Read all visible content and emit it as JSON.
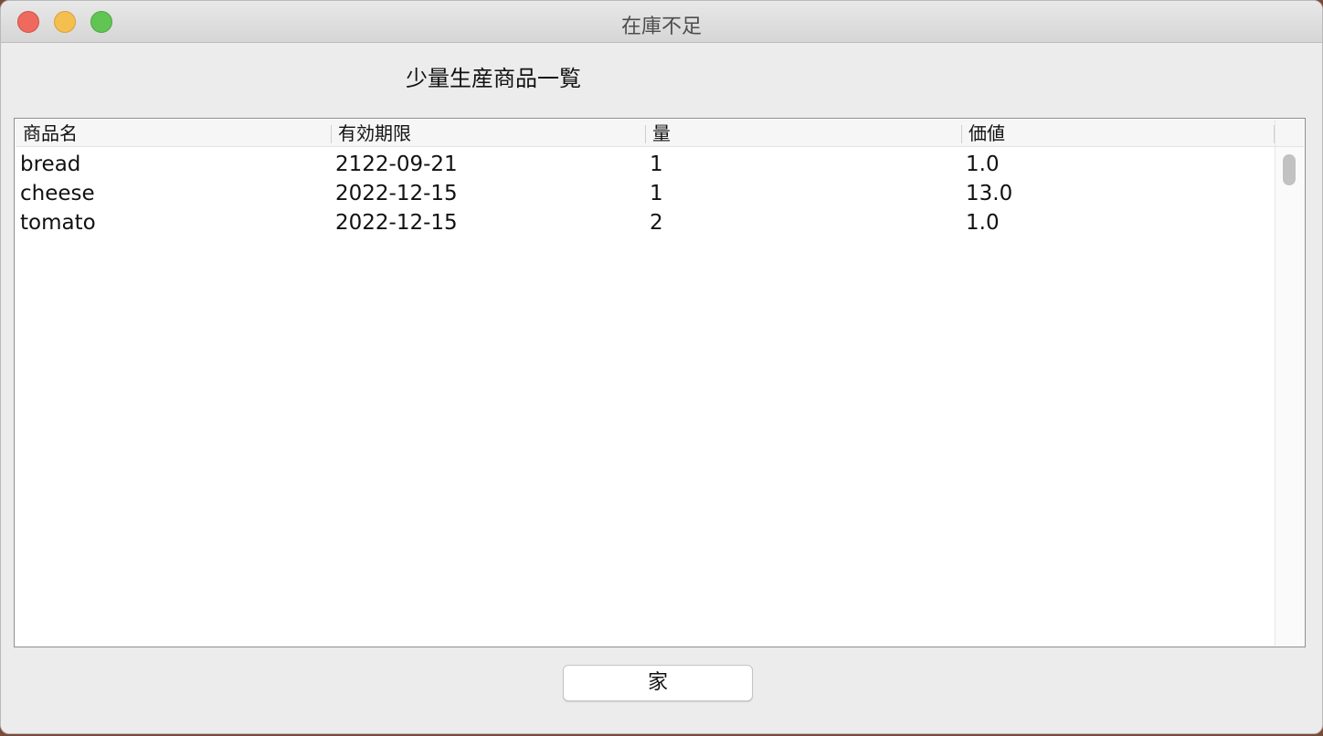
{
  "window": {
    "title": "在庫不足"
  },
  "main": {
    "heading": "少量生産商品一覧",
    "home_button_label": "家"
  },
  "table": {
    "columns": [
      "商品名",
      "有効期限",
      "量",
      "価値"
    ],
    "rows": [
      [
        "bread",
        "2122-09-21",
        "1",
        "1.0"
      ],
      [
        "cheese",
        "2022-12-15",
        "1",
        "13.0"
      ],
      [
        "tomato",
        "2022-12-15",
        "2",
        "1.0"
      ]
    ]
  },
  "colors": {
    "close": "#ee6a5f",
    "minimize": "#f5bf4f",
    "maximize": "#61c554",
    "window_bg": "#ececec"
  }
}
